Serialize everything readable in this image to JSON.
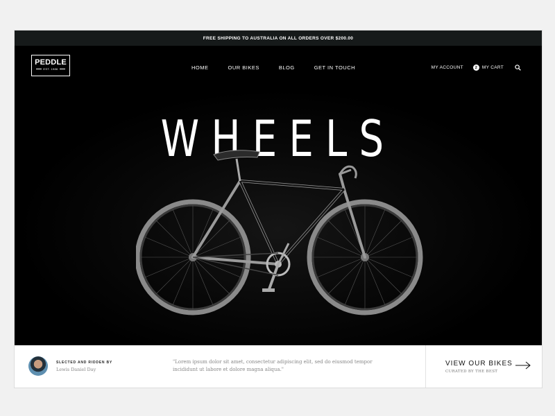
{
  "promo": {
    "text": "FREE SHIPPING TO AUSTRALIA ON ALL ORDERS OVER $200.00"
  },
  "logo": {
    "name": "PEDDLE",
    "tagline": "EST. 1986"
  },
  "nav": {
    "items": [
      {
        "label": "HOME"
      },
      {
        "label": "OUR BIKES"
      },
      {
        "label": "BLOG"
      },
      {
        "label": "GET IN TOUCH"
      }
    ]
  },
  "account": {
    "my_account": "MY ACCOUNT",
    "cart_count": "2",
    "my_cart": "MY CART",
    "search_icon": "search-icon"
  },
  "hero": {
    "title": "WHEELS"
  },
  "footer": {
    "selected_label": "SLECTED AND RIDDEN BY",
    "rider_name": "Lewis Daniel Day",
    "quote": "\"Lorem ipsum dolor sit amet, consectetur adipiscing elit, sed do eiusmod tempor incididunt ut labore et dolore magna aliqua.\"",
    "cta_title": "VIEW OUR BIKES",
    "cta_subtitle": "CURATED BY THE BEST",
    "arrow_icon": "arrow-right-icon"
  },
  "colors": {
    "page_bg": "#f1f1f1",
    "promo_bg": "#161a1a",
    "hero_bg": "#000000",
    "footer_bg": "#ffffff"
  }
}
